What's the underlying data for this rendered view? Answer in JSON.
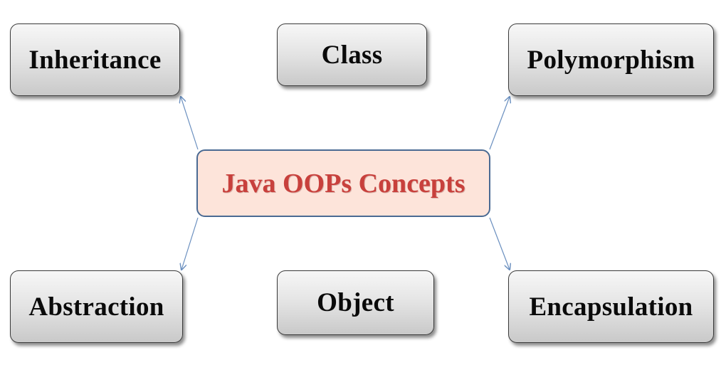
{
  "diagram": {
    "center": {
      "label": "Java OOPs Concepts"
    },
    "nodes": {
      "inheritance": "Inheritance",
      "class": "Class",
      "polymorphism": "Polymorphism",
      "abstraction": "Abstraction",
      "object": "Object",
      "encapsulation": "Encapsulation"
    },
    "colors": {
      "center_fill": "#fde4da",
      "center_border": "#4a6a93",
      "center_text": "#c8403c",
      "node_fill": "#e3e3e3",
      "node_text": "#0a0a0a",
      "arrow": "#6a8fbf"
    }
  }
}
